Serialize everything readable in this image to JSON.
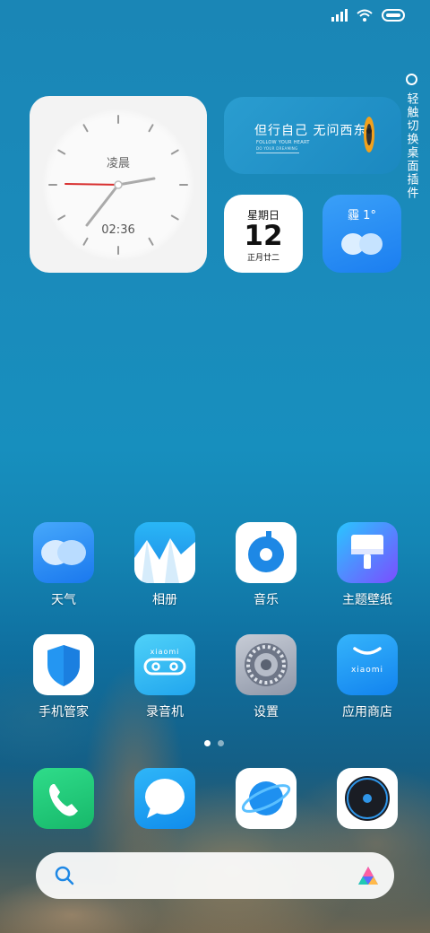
{
  "clock_widget": {
    "period": "凌晨",
    "time": "02:36"
  },
  "quote_widget": {
    "text": "但行自己 无问西东",
    "sub1": "FOLLOW YOUR HEART",
    "sub2": "DO YOUR DREAMING"
  },
  "side_hint": {
    "text": "轻触切换桌面插件"
  },
  "calendar_widget": {
    "weekday": "星期日",
    "day": "12",
    "lunar": "正月廿二"
  },
  "weather_widget": {
    "condition": "霾 1°"
  },
  "apps_row1": [
    {
      "label": "天气"
    },
    {
      "label": "相册"
    },
    {
      "label": "音乐"
    },
    {
      "label": "主题壁纸"
    }
  ],
  "apps_row2": [
    {
      "label": "手机管家"
    },
    {
      "label": "录音机"
    },
    {
      "label": "设置"
    },
    {
      "label": "应用商店"
    }
  ],
  "icon_brand_text": "xiaomi",
  "colors": {
    "weather_blue": "#2e8cf5",
    "security_blue": "#2496f2",
    "phone_green": "#1fc97a",
    "message_blue": "#1aa3f2"
  }
}
